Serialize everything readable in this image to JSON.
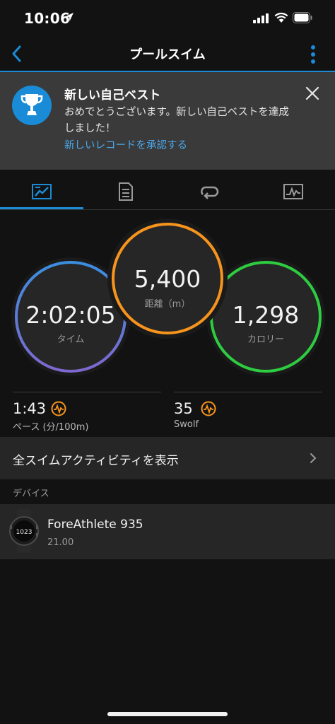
{
  "status_bar": {
    "time": "10:06"
  },
  "nav": {
    "title": "プールスイム"
  },
  "banner": {
    "title": "新しい自己ベスト",
    "message": "おめでとうございます。新しい自己ベストを達成しました！",
    "link": "新しいレコードを承認する"
  },
  "tabs": [
    {
      "icon": "stats-icon",
      "active": true
    },
    {
      "icon": "document-icon",
      "active": false
    },
    {
      "icon": "laps-icon",
      "active": false
    },
    {
      "icon": "chart-icon",
      "active": false
    }
  ],
  "metrics": {
    "time": {
      "value": "2:02:05",
      "label": "タイム",
      "color": "#7b6fd6"
    },
    "distance": {
      "value": "5,400",
      "label": "距離（m）",
      "color": "#f7941d"
    },
    "calories": {
      "value": "1,298",
      "label": "カロリー",
      "color": "#2ecc40"
    }
  },
  "stats": {
    "pace": {
      "value": "1:43",
      "label": "ペース (分/100m)"
    },
    "swolf": {
      "value": "35",
      "label": "Swolf"
    }
  },
  "all_activities": {
    "label": "全スイムアクティビティを表示"
  },
  "devices_section": {
    "label": "デバイス"
  },
  "device": {
    "name": "ForeAthlete 935",
    "version": "21.00",
    "watch_face_text": "1023"
  },
  "colors": {
    "accent": "#1a8bd6",
    "effort_icon": "#f7941d"
  }
}
